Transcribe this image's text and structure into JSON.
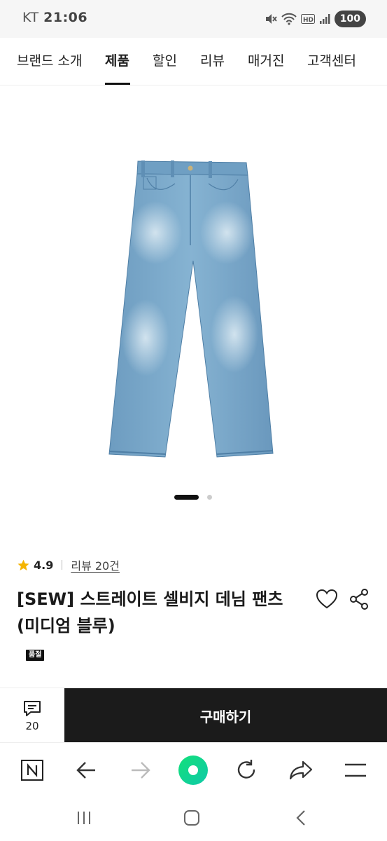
{
  "status_bar": {
    "carrier": "KT",
    "time": "21:06",
    "battery": "100"
  },
  "nav": {
    "tabs": [
      {
        "label": "브랜드 소개",
        "active": false
      },
      {
        "label": "제품",
        "active": true
      },
      {
        "label": "할인",
        "active": false
      },
      {
        "label": "리뷰",
        "active": false
      },
      {
        "label": "매거진",
        "active": false
      },
      {
        "label": "고객센터",
        "active": false
      }
    ]
  },
  "product": {
    "image_icon": "denim-pants-image",
    "carousel": {
      "current": 1,
      "total": 2
    },
    "rating": "4.9",
    "review_link": "리뷰 20건",
    "title_line1": "[SEW] 스트레이트 셀비지 데님 팬츠",
    "title_line2": "(미디엄 블루)",
    "badge": "품절"
  },
  "purchase_bar": {
    "review_count": "20",
    "buy_label": "구매하기"
  },
  "colors": {
    "accent_dark": "#1b1b1b",
    "star": "#f5b400",
    "denim": "#7ea9c9"
  }
}
